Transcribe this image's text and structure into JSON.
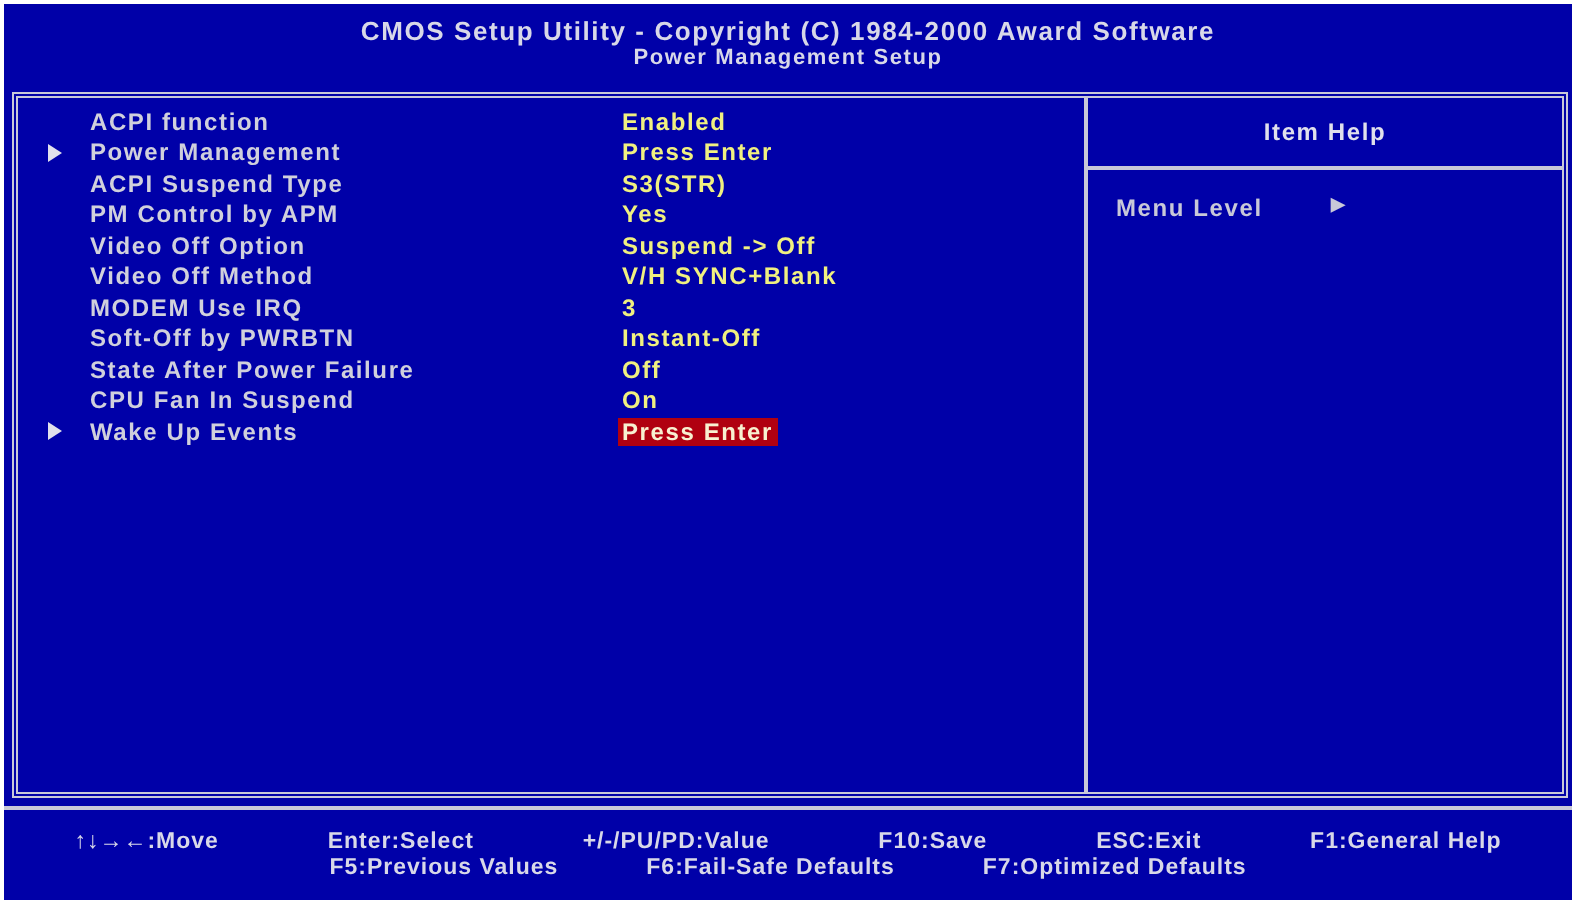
{
  "header": {
    "title": "CMOS Setup Utility - Copyright (C) 1984-2000 Award Software",
    "subtitle": "Power Management Setup"
  },
  "items": [
    {
      "label": "ACPI function",
      "value": "Enabled",
      "submenu": false,
      "selected": false
    },
    {
      "label": "Power Management",
      "value": "Press Enter",
      "submenu": true,
      "selected": false
    },
    {
      "label": "ACPI Suspend Type",
      "value": "S3(STR)",
      "submenu": false,
      "selected": false
    },
    {
      "label": "PM Control by APM",
      "value": "Yes",
      "submenu": false,
      "selected": false
    },
    {
      "label": "Video Off Option",
      "value": "Suspend -> Off",
      "submenu": false,
      "selected": false
    },
    {
      "label": "Video Off Method",
      "value": "V/H SYNC+Blank",
      "submenu": false,
      "selected": false
    },
    {
      "label": "MODEM Use IRQ",
      "value": "3",
      "submenu": false,
      "selected": false
    },
    {
      "label": "Soft-Off by PWRBTN",
      "value": "Instant-Off",
      "submenu": false,
      "selected": false
    },
    {
      "label": "State After Power Failure",
      "value": "Off",
      "submenu": false,
      "selected": false
    },
    {
      "label": "CPU Fan In Suspend",
      "value": "On",
      "submenu": false,
      "selected": false
    },
    {
      "label": "Wake Up Events",
      "value": "Press Enter",
      "submenu": true,
      "selected": true
    }
  ],
  "item_help": {
    "title": "Item Help",
    "menu_level_label": "Menu Level",
    "menu_level_marker": "▶"
  },
  "footer": [
    [
      "↑↓→←:Move",
      "Enter:Select",
      "+/-/PU/PD:Value",
      "F10:Save",
      "ESC:Exit",
      "F1:General Help"
    ],
    [
      "F5:Previous Values",
      "F6:Fail-Safe Defaults",
      "F7:Optimized Defaults"
    ]
  ]
}
